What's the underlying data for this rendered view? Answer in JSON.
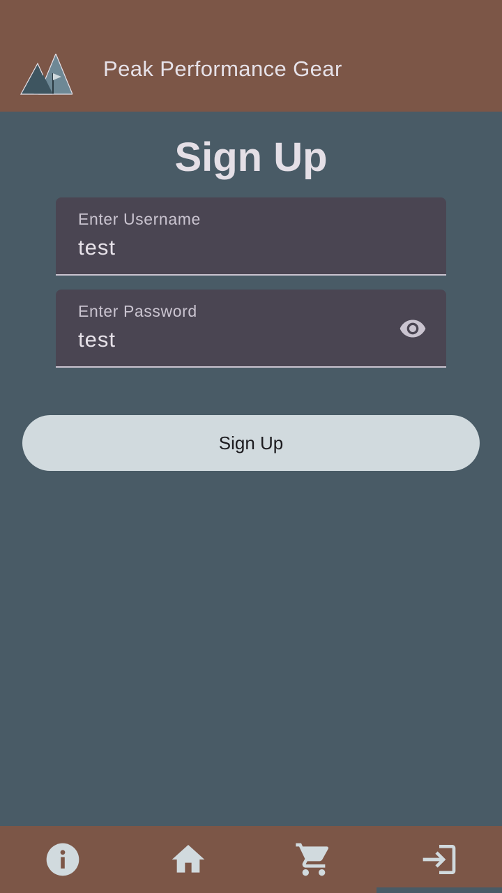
{
  "app": {
    "title": "Peak Performance Gear"
  },
  "page": {
    "title": "Sign Up"
  },
  "form": {
    "username": {
      "label": "Enter Username",
      "value": "test"
    },
    "password": {
      "label": "Enter Password",
      "value": "test"
    },
    "submit_label": "Sign Up"
  },
  "nav": {
    "items": [
      {
        "icon": "info-icon"
      },
      {
        "icon": "home-icon"
      },
      {
        "icon": "cart-icon"
      },
      {
        "icon": "login-icon",
        "selected": true
      }
    ]
  },
  "colors": {
    "appbar": "#7c5647",
    "background": "#495b66",
    "field": "#4a4552",
    "button": "#d1dade"
  }
}
